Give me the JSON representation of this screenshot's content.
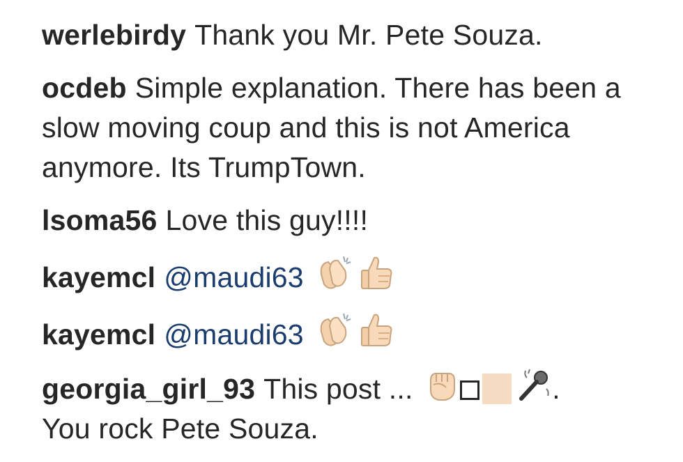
{
  "comments": [
    {
      "username": "werlebirdy",
      "text": "Thank you Mr. Pete Souza."
    },
    {
      "username": "ocdeb",
      "text": "Simple explanation. There has been a slow moving coup and this is not America anymore. Its TrumpTown."
    },
    {
      "username": "lsoma56",
      "text": "Love this guy!!!!"
    },
    {
      "username": "kayemcl",
      "mention": "@maudi63",
      "emojis": [
        "clapping-hands-icon",
        "thumbs-up-icon"
      ]
    },
    {
      "username": "kayemcl",
      "mention": "@maudi63",
      "emojis": [
        "clapping-hands-icon",
        "thumbs-up-icon"
      ]
    },
    {
      "username": "georgia_girl_93",
      "text_before": "This post ...",
      "text_after": ".",
      "text_line2": "You rock Pete Souza.",
      "emojis": [
        "raised-fist-icon",
        "missing-glyph-box",
        "skin-tone-swatch",
        "microphone-icon"
      ]
    }
  ],
  "colors": {
    "text": "#262626",
    "mention": "#1b3d6e",
    "skin_tone": "#f7dcc4"
  }
}
